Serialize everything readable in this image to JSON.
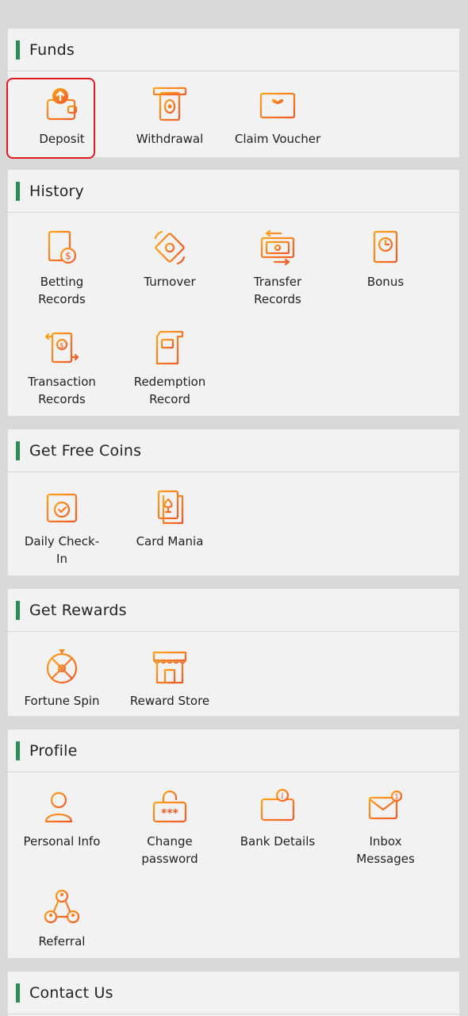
{
  "colors": {
    "accent_bar": "#2e8b57",
    "icon_gradient_start": "#ff8c1a",
    "icon_gradient_end": "#f05a28",
    "selected_border": "#e0191f"
  },
  "sections": {
    "funds": {
      "title": "Funds",
      "items": [
        {
          "label": "Deposit",
          "icon": "wallet-upload-icon"
        },
        {
          "label": "Withdrawal",
          "icon": "cash-withdraw-icon"
        },
        {
          "label": "Claim Voucher",
          "icon": "gift-voucher-icon"
        }
      ]
    },
    "history": {
      "title": "History",
      "items": [
        {
          "label": "Betting\nRecords",
          "icon": "betting-records-icon"
        },
        {
          "label": "Turnover",
          "icon": "turnover-icon"
        },
        {
          "label": "Transfer\nRecords",
          "icon": "transfer-records-icon"
        },
        {
          "label": "Bonus",
          "icon": "bonus-icon"
        },
        {
          "label": "Transaction\nRecords",
          "icon": "transaction-records-icon"
        },
        {
          "label": "Redemption\nRecord",
          "icon": "redemption-record-icon"
        }
      ]
    },
    "free_coins": {
      "title": "Get Free Coins",
      "items": [
        {
          "label": "Daily Check-\nIn",
          "icon": "calendar-check-icon"
        },
        {
          "label": "Card Mania",
          "icon": "playing-card-icon"
        }
      ]
    },
    "rewards": {
      "title": "Get Rewards",
      "items": [
        {
          "label": "Fortune Spin",
          "icon": "fortune-wheel-icon"
        },
        {
          "label": "Reward Store",
          "icon": "store-icon"
        }
      ]
    },
    "profile": {
      "title": "Profile",
      "items": [
        {
          "label": "Personal Info",
          "icon": "user-icon"
        },
        {
          "label": "Change\npassword",
          "icon": "lock-password-icon"
        },
        {
          "label": "Bank Details",
          "icon": "bank-card-icon"
        },
        {
          "label": "Inbox\nMessages",
          "icon": "mail-icon"
        },
        {
          "label": "Referral",
          "icon": "referral-icon"
        }
      ]
    },
    "contact": {
      "title": "Contact Us"
    }
  }
}
